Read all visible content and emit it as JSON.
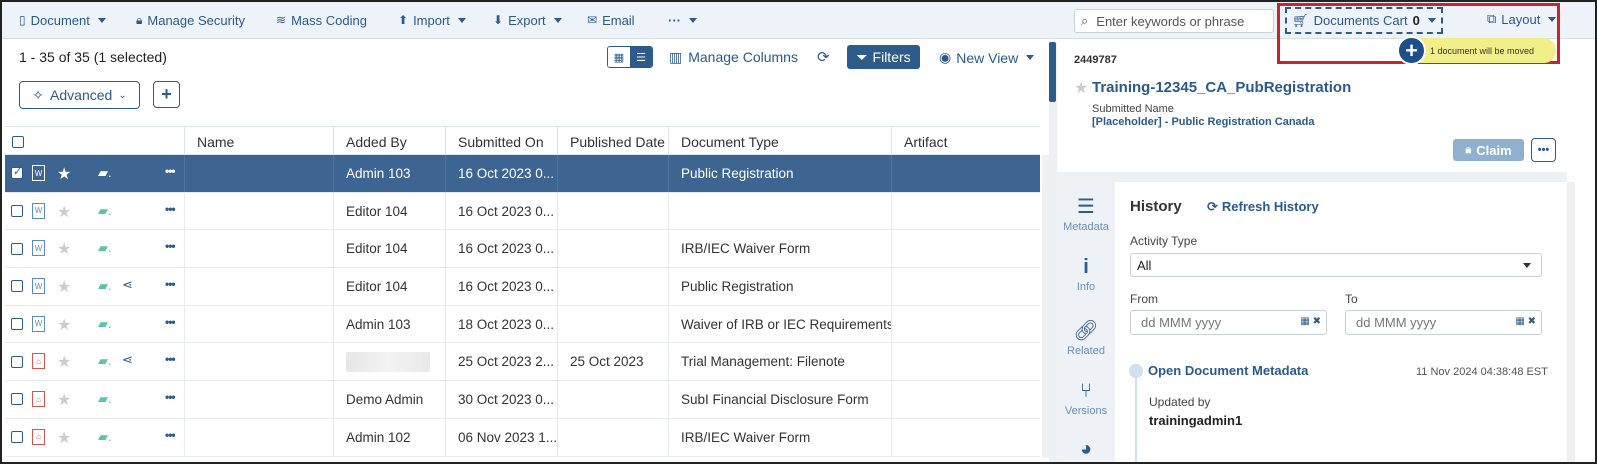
{
  "toolbar": {
    "document": "Document",
    "manage_security": "Manage Security",
    "mass_coding": "Mass Coding",
    "import": "Import",
    "export": "Export",
    "email": "Email",
    "more": "···",
    "search_placeholder": "Enter keywords or phrase",
    "cart_label": "Documents Cart",
    "cart_count": "0",
    "layout": "Layout",
    "tooltip": "1 document will be moved"
  },
  "list_toolbar": {
    "count": "1 - 35 of 35 (1 selected)",
    "manage_columns": "Manage Columns",
    "filters": "Filters",
    "new_view": "New View",
    "advanced": "Advanced"
  },
  "table": {
    "columns": [
      "Name",
      "Added By",
      "Submitted On",
      "Published Date",
      "Document Type",
      "Artifact"
    ],
    "rows": [
      {
        "added_by": "Admin 103",
        "submitted_on": "16 Oct 2023 0...",
        "published": "",
        "doc_type": "Public Registration",
        "artifact": "",
        "file": "word",
        "selected": true
      },
      {
        "added_by": "Editor 104",
        "submitted_on": "16 Oct 2023 0...",
        "published": "",
        "doc_type": "",
        "artifact": "",
        "file": "word"
      },
      {
        "added_by": "Editor 104",
        "submitted_on": "16 Oct 2023 0...",
        "published": "",
        "doc_type": "IRB/IEC Waiver Form",
        "artifact": "",
        "file": "word"
      },
      {
        "added_by": "Editor 104",
        "submitted_on": "16 Oct 2023 0...",
        "published": "",
        "doc_type": "Public Registration",
        "artifact": "",
        "file": "word",
        "shared": true
      },
      {
        "added_by": "Admin 103",
        "submitted_on": "18 Oct 2023 0...",
        "published": "",
        "doc_type": "Waiver of IRB or IEC Requirements",
        "artifact": "",
        "file": "word"
      },
      {
        "added_by": "",
        "submitted_on": "25 Oct 2023 2...",
        "published": "25 Oct 2023",
        "doc_type": "Trial Management: Filenote",
        "artifact": "",
        "file": "pdf",
        "shared": true,
        "redacted": true
      },
      {
        "added_by": "Demo Admin",
        "submitted_on": "30 Oct 2023 0...",
        "published": "",
        "doc_type": "SubI Financial Disclosure Form",
        "artifact": "",
        "file": "pdf"
      },
      {
        "added_by": "Admin 102",
        "submitted_on": "06 Nov 2023 1...",
        "published": "",
        "doc_type": "IRB/IEC Waiver Form",
        "artifact": "",
        "file": "pdf"
      }
    ]
  },
  "detail": {
    "id": "2449787",
    "title": "Training-12345_CA_PubRegistration",
    "submitted_name_label": "Submitted Name",
    "submitted_name": "[Placeholder] - Public Registration Canada",
    "claim": "Claim",
    "tabs": [
      "Metadata",
      "Info",
      "Related",
      "Versions"
    ],
    "history_title": "History",
    "refresh_history": "Refresh History",
    "activity_type_label": "Activity Type",
    "activity_type_value": "All",
    "from_label": "From",
    "to_label": "To",
    "date_placeholder": "dd MMM yyyy",
    "event_title": "Open Document Metadata",
    "event_timestamp": "11 Nov 2024 04:38:48 EST",
    "updated_by_label": "Updated by",
    "updated_by_user": "trainingadmin1"
  }
}
